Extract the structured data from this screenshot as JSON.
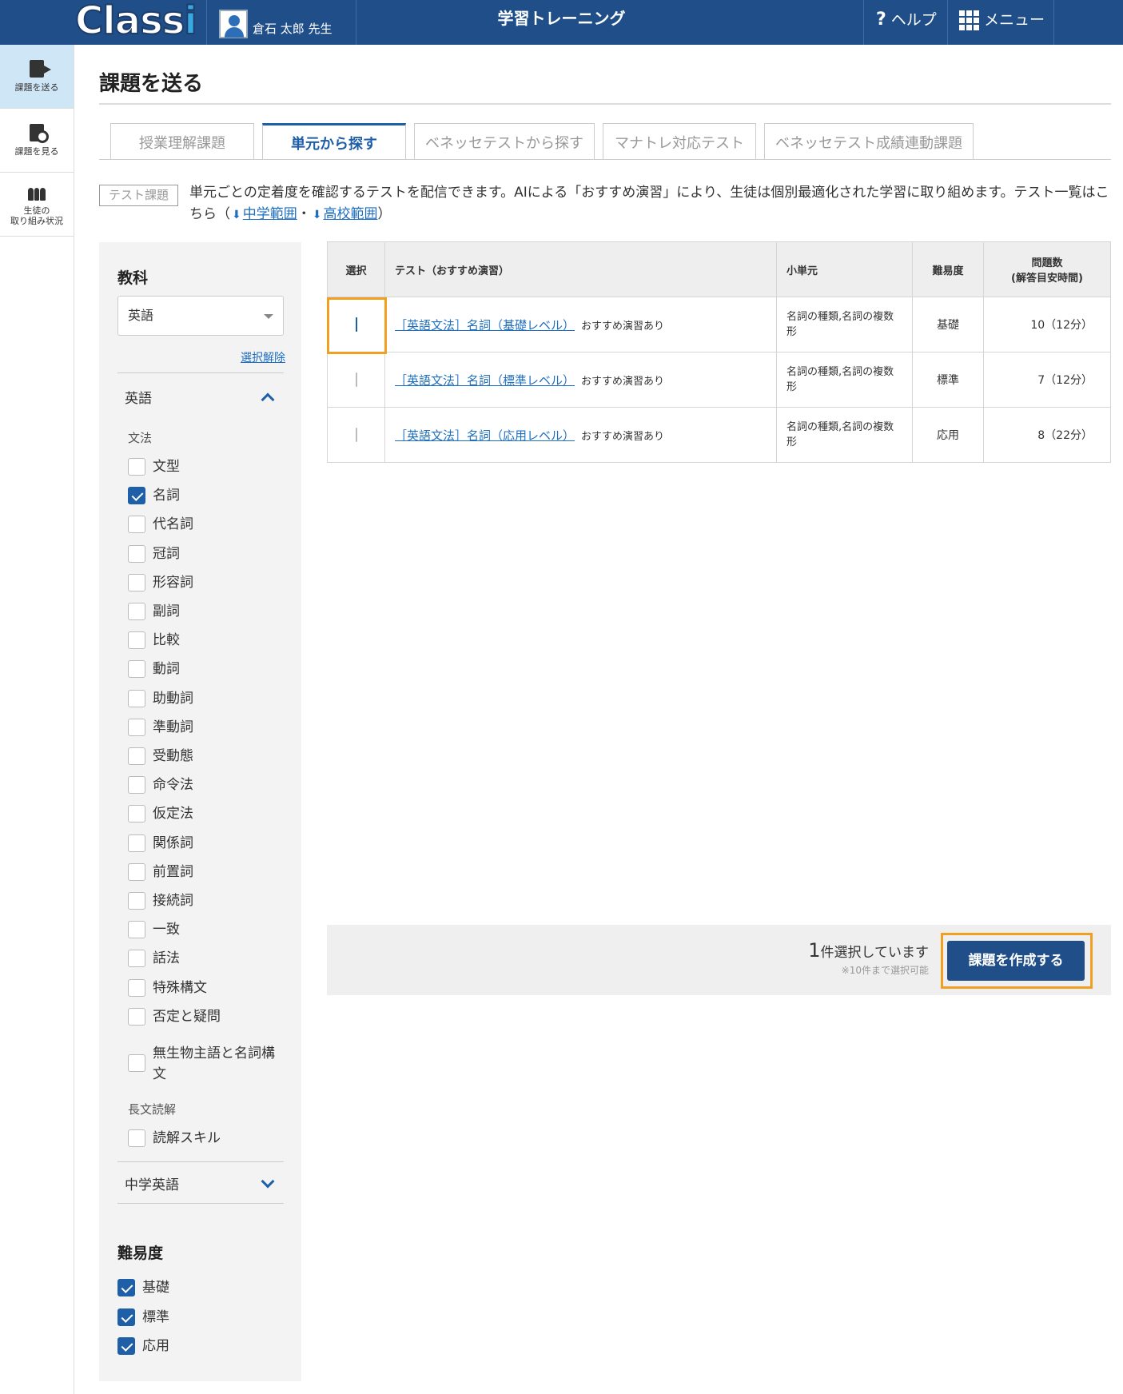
{
  "header": {
    "logo_text": "Class",
    "logo_i": "i",
    "user_name": "倉石 太郎 先生",
    "app_title": "学習トレーニング",
    "help_label": "ヘルプ",
    "menu_label": "メニュー",
    "help_icon": "question-icon",
    "menu_icon": "grid-icon"
  },
  "sidebar": {
    "items": [
      {
        "label": "課題を送る",
        "icon": "send-assignment-icon",
        "active": true
      },
      {
        "label": "課題を見る",
        "icon": "view-assignment-icon",
        "active": false
      },
      {
        "label": "生徒の",
        "label2": "取り組み状況",
        "icon": "students-icon",
        "active": false
      }
    ]
  },
  "main": {
    "title": "課題を送る",
    "tabs": [
      {
        "label": "授業理解課題"
      },
      {
        "label": "単元から探す",
        "active": true
      },
      {
        "label": "ベネッセテストから探す"
      },
      {
        "label": "マナトレ対応テスト"
      },
      {
        "label": "ベネッセテスト成績連動課題"
      }
    ],
    "tag": "テスト課題",
    "description": "単元ごとの定着度を確認するテストを配信できます。AIによる「おすすめ演習」により、生徒は個別最適化された学習に取り組めます。テスト一覧はこちら（",
    "link_junior": "中学範囲",
    "link_sep": "・",
    "link_senior": "高校範囲",
    "desc_end": "）"
  },
  "filter": {
    "subject_heading": "教科",
    "subject_value": "英語",
    "clear_label": "選択解除",
    "section_label": "英語",
    "group1": "文法",
    "grammar": [
      {
        "label": "文型",
        "checked": false
      },
      {
        "label": "名詞",
        "checked": true
      },
      {
        "label": "代名詞",
        "checked": false
      },
      {
        "label": "冠詞",
        "checked": false
      },
      {
        "label": "形容詞",
        "checked": false
      },
      {
        "label": "副詞",
        "checked": false
      },
      {
        "label": "比較",
        "checked": false
      },
      {
        "label": "動詞",
        "checked": false
      },
      {
        "label": "助動詞",
        "checked": false
      },
      {
        "label": "準動詞",
        "checked": false
      },
      {
        "label": "受動態",
        "checked": false
      },
      {
        "label": "命令法",
        "checked": false
      },
      {
        "label": "仮定法",
        "checked": false
      },
      {
        "label": "関係詞",
        "checked": false
      },
      {
        "label": "前置詞",
        "checked": false
      },
      {
        "label": "接続詞",
        "checked": false
      },
      {
        "label": "一致",
        "checked": false
      },
      {
        "label": "話法",
        "checked": false
      },
      {
        "label": "特殊構文",
        "checked": false
      },
      {
        "label": "否定と疑問",
        "checked": false
      }
    ],
    "grammar_last_line1": "無生物主語と名詞構",
    "grammar_last_line2": "文",
    "group2": "長文読解",
    "reading": [
      {
        "label": "読解スキル",
        "checked": false
      }
    ],
    "section2_label": "中学英語",
    "difficulty_heading": "難易度",
    "difficulty": [
      {
        "label": "基礎",
        "checked": true
      },
      {
        "label": "標準",
        "checked": true
      },
      {
        "label": "応用",
        "checked": true
      }
    ]
  },
  "table": {
    "headers": {
      "select": "選択",
      "test": "テスト（おすすめ演習）",
      "unit": "小単元",
      "difficulty": "難易度",
      "count": "問題数",
      "count_sub": "(解答目安時間)"
    },
    "rows": [
      {
        "checked": true,
        "title": "［英語文法］名詞（基礎レベル）",
        "note": "おすすめ演習あり",
        "unit_line1": "名詞の種類,名詞の複数",
        "unit_line2": "形",
        "difficulty": "基礎",
        "count": "10（12分）"
      },
      {
        "checked": false,
        "title": "［英語文法］名詞（標準レベル）",
        "note": "おすすめ演習あり",
        "unit_line1": "名詞の種類,名詞の複数",
        "unit_line2": "形",
        "difficulty": "標準",
        "count": "7（12分）"
      },
      {
        "checked": false,
        "title": "［英語文法］名詞（応用レベル）",
        "note": "おすすめ演習あり",
        "unit_line1": "名詞の種類,名詞の複数",
        "unit_line2": "形",
        "difficulty": "応用",
        "count": "8（22分）"
      }
    ]
  },
  "footer": {
    "selected_count": "1",
    "selected_text": "件選択しています",
    "limit_note": "※10件まで選択可能",
    "create_button": "課題を作成する"
  },
  "colors": {
    "header_bg": "#1f4e89",
    "accent": "#1f5fa8",
    "link": "#1f6fc0",
    "highlight": "#f0a020",
    "sidebar_active": "#cfe6f7"
  }
}
